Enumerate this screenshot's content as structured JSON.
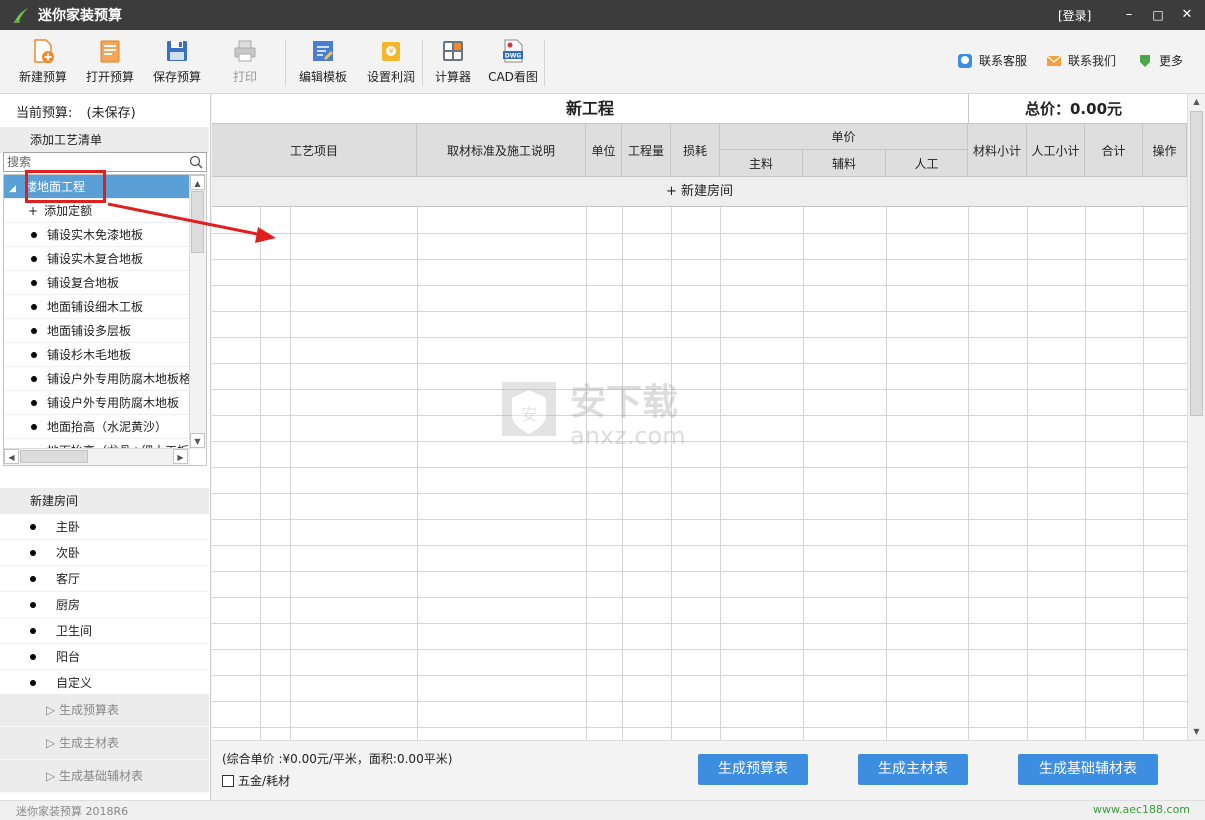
{
  "window": {
    "title": "迷你家装预算",
    "login_label": "[登录]",
    "minimize": "–",
    "maximize": "□",
    "close": "✕"
  },
  "toolbar": {
    "buttons": [
      {
        "label": "新建预算",
        "icon": "new-budget-icon",
        "enabled": true
      },
      {
        "label": "打开预算",
        "icon": "open-budget-icon",
        "enabled": true
      },
      {
        "label": "保存预算",
        "icon": "save-icon",
        "enabled": true
      },
      {
        "label": "打印",
        "icon": "printer-icon",
        "enabled": false
      },
      {
        "label": "编辑模板",
        "icon": "edit-template-icon",
        "enabled": true
      },
      {
        "label": "设置利润",
        "icon": "profit-icon",
        "enabled": true
      },
      {
        "label": "计算器",
        "icon": "calculator-icon",
        "enabled": true
      },
      {
        "label": "CAD看图",
        "icon": "dwg-icon",
        "enabled": true
      }
    ],
    "links": [
      {
        "label": "联系客服",
        "icon": "chat-icon"
      },
      {
        "label": "联系我们",
        "icon": "mail-icon"
      },
      {
        "label": "更多",
        "icon": "more-icon"
      }
    ]
  },
  "left": {
    "current_budget_label": "当前预算:",
    "current_budget_value": "(未保存)",
    "craft_header": "添加工艺清单",
    "search_placeholder": "搜索",
    "tree_root": "楼地面工程",
    "tree_items": [
      {
        "label": "添加定额",
        "kind": "add"
      },
      {
        "label": "铺设实木免漆地板",
        "kind": "item"
      },
      {
        "label": "铺设实木复合地板",
        "kind": "item"
      },
      {
        "label": "铺设复合地板",
        "kind": "item"
      },
      {
        "label": "地面铺设细木工板",
        "kind": "item"
      },
      {
        "label": "地面铺设多层板",
        "kind": "item"
      },
      {
        "label": "铺设杉木毛地板",
        "kind": "item"
      },
      {
        "label": "铺设户外专用防腐木地板格",
        "kind": "item"
      },
      {
        "label": "铺设户外专用防腐木地板",
        "kind": "item"
      },
      {
        "label": "地面抬高（水泥黄沙）",
        "kind": "item"
      },
      {
        "label": "地面抬高（龙骨+细木工板）",
        "kind": "item"
      }
    ],
    "rooms_header": "新建房间",
    "rooms": [
      "主卧",
      "次卧",
      "客厅",
      "厨房",
      "卫生间",
      "阳台",
      "自定义"
    ],
    "gen_links": [
      "▷ 生成预算表",
      "▷ 生成主材表",
      "▷ 生成基础辅材表"
    ]
  },
  "main": {
    "project_title": "新工程",
    "total_label": "总价：0.00元",
    "columns": {
      "craft": "工艺项目",
      "spec": "取材标准及施工说明",
      "unit": "单位",
      "quantity": "工程量",
      "loss": "损耗",
      "unit_price": "单价",
      "main_mat": "主料",
      "aux_mat": "辅料",
      "labor": "人工",
      "mat_subtotal": "材料小计",
      "labor_subtotal": "人工小计",
      "sum": "合计",
      "ops": "操作"
    },
    "new_room_label": "+ 新建房间"
  },
  "footer": {
    "summary": "(综合单价 :¥0.00元/平米，面积:0.00平米)",
    "hardware_label": "五金/耗材",
    "buttons": [
      "生成预算表",
      "生成主材表",
      "生成基础辅材表"
    ]
  },
  "watermark": {
    "cn": "安下载",
    "en": "anxz.com"
  },
  "status": {
    "version": "迷你家装预算 2018R6",
    "site": "www.aec188.com"
  },
  "colors": {
    "titlebar": "#3c3c3c",
    "selection": "#5a9fd6",
    "button_blue": "#3d8ee0",
    "highlight_red": "#e02020"
  }
}
